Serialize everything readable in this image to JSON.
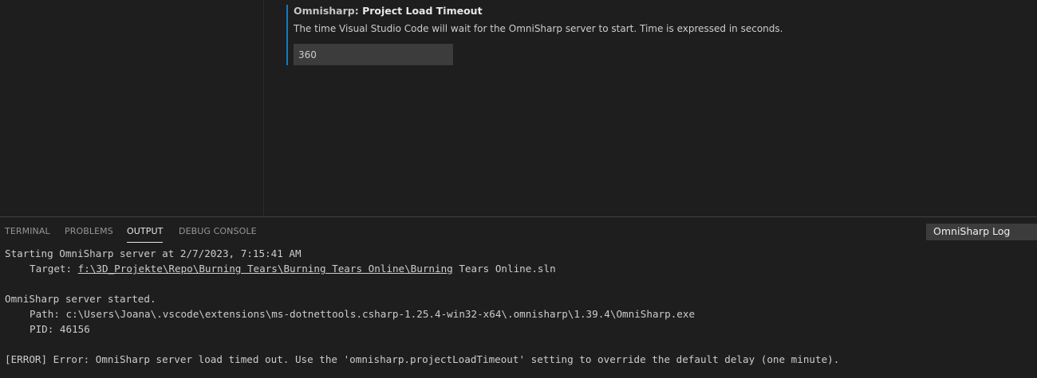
{
  "setting": {
    "category": "Omnisharp: ",
    "name": "Project Load Timeout",
    "description": "The time Visual Studio Code will wait for the OmniSharp server to start. Time is expressed in seconds.",
    "value": "360"
  },
  "panel": {
    "tabs": [
      {
        "label": "TERMINAL",
        "active": false
      },
      {
        "label": "PROBLEMS",
        "active": false
      },
      {
        "label": "OUTPUT",
        "active": true
      },
      {
        "label": "DEBUG CONSOLE",
        "active": false
      }
    ],
    "channel": "OmniSharp Log"
  },
  "output": {
    "line1": "Starting OmniSharp server at 2/7/2023, 7:15:41 AM",
    "target_label": "Target: ",
    "target_link": "f:\\3D_Projekte\\Repo\\Burning Tears\\Burning Tears Online\\Burning",
    "target_rest": " Tears Online.sln",
    "line3": "OmniSharp server started.",
    "line4": "Path: c:\\Users\\Joana\\.vscode\\extensions\\ms-dotnettools.csharp-1.25.4-win32-x64\\.omnisharp\\1.39.4\\OmniSharp.exe",
    "line5": "PID: 46156",
    "line6": "[ERROR] Error: OmniSharp server load timed out. Use the 'omnisharp.projectLoadTimeout' setting to override the default delay (one minute)."
  },
  "colors": {
    "focus_accent": "#007fd4",
    "background": "#1e1e1e",
    "input_background": "#3c3c3c"
  }
}
